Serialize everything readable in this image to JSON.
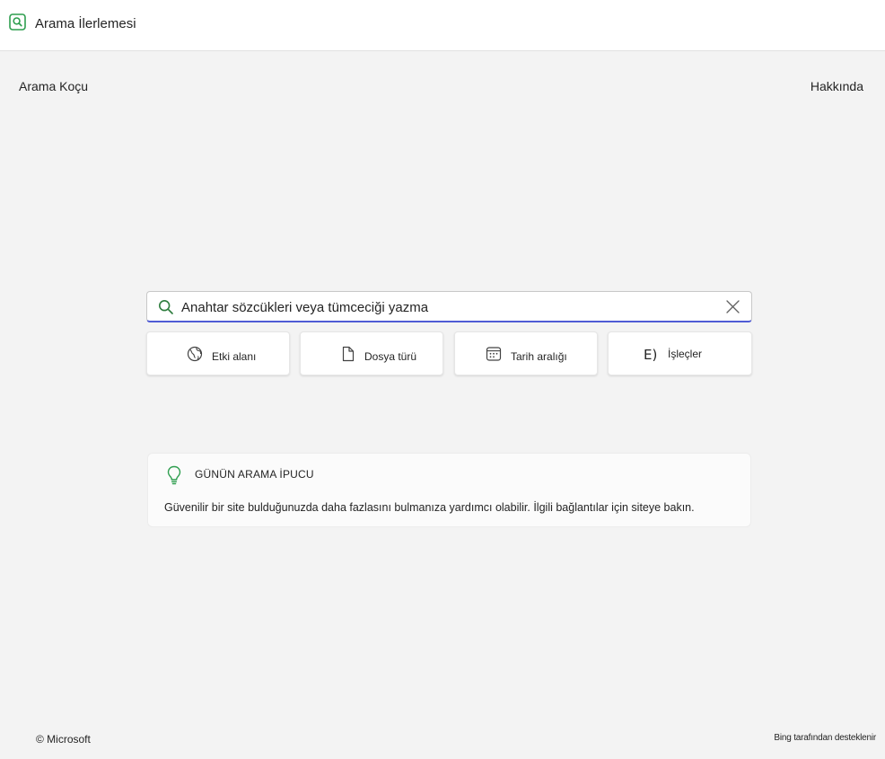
{
  "app": {
    "title": "Arama İlerlemesi",
    "accent_color": "#2e9e4f",
    "icon": "search-icon"
  },
  "nav": {
    "left_link": "Arama Koçu",
    "right_link": "Hakkında"
  },
  "search": {
    "placeholder": "Anahtar sözcükleri veya tümceciği yazma",
    "value": "",
    "focus_color": "#4f5bd5",
    "icons": {
      "search": "search-icon",
      "clear": "close-icon"
    }
  },
  "filters": [
    {
      "label": "Etki alanı",
      "icon": "globe-icon"
    },
    {
      "label": "Dosya türü",
      "icon": "document-icon"
    },
    {
      "label": "Tarih aralığı",
      "icon": "calendar-icon"
    },
    {
      "label": "İşleçler",
      "icon": "operators-icon",
      "icon_glyph": "E)"
    }
  ],
  "tip": {
    "heading": "GÜNÜN ARAMA İPUCU",
    "text": "Güvenilir bir site bulduğunuzda daha fazlasını bulmanıza yardımcı olabilir. İlgili bağlantılar için siteye bakın.",
    "icon": "lightbulb-icon",
    "icon_color": "#2e9e4f"
  },
  "footer": {
    "copyright": "© Microsoft",
    "powered_by": "Bing tarafından desteklenir"
  }
}
